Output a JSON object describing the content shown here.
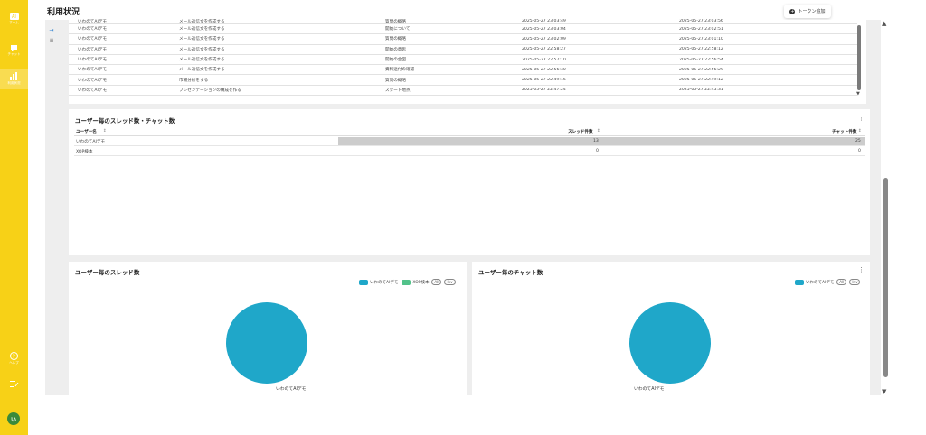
{
  "sidebar": {
    "items": [
      {
        "icon": "home-icon",
        "label": "ホーム"
      },
      {
        "icon": "chat-icon",
        "label": "チャット"
      },
      {
        "icon": "analytics-icon",
        "label": "利用状況"
      },
      {
        "icon": "help-icon",
        "label": "ヘルプ"
      },
      {
        "icon": "notes-icon",
        "label": ""
      }
    ],
    "avatar": "い"
  },
  "header": {
    "title": "利用状況",
    "token_button": "トークン追加"
  },
  "history_table": {
    "rows": [
      [
        "いわのてAIデモ",
        "メール返信文を作成する",
        "質問の概略",
        "2025-05-27 23:03:49",
        "2025-05-27 23:03:56"
      ],
      [
        "いわのてAIデモ",
        "メール返信文を作成する",
        "開始について",
        "2025-05-27 23:03:04",
        "2025-05-27 23:02:51"
      ],
      [
        "いわのてAIデモ",
        "メール返信文を作成する",
        "質問の概略",
        "2025-05-27 23:02:09",
        "2025-05-27 23:01:10"
      ],
      [
        "いわのてAIデモ",
        "メール返信文を作成する",
        "開始の意思",
        "2025-05-27 22:58:27",
        "2025-05-27 22:58:12"
      ],
      [
        "いわのてAIデモ",
        "メール返信文を作成する",
        "開始の合図",
        "2025-05-27 22:57:10",
        "2025-05-27 22:56:54"
      ],
      [
        "いわのてAIデモ",
        "メール返信文を作成する",
        "資料送付の確認",
        "2025-05-27 22:56:40",
        "2025-05-27 22:56:29"
      ],
      [
        "いわのてAIデモ",
        "市場分析をする",
        "質問の概略",
        "2025-05-27 22:49:16",
        "2025-05-27 22:49:12"
      ],
      [
        "いわのてAIデモ",
        "プレゼンテーションの構成を作る",
        "スタート地点",
        "2025-05-27 22:47:24",
        "2025-05-27 22:45:31"
      ]
    ]
  },
  "threads_chats": {
    "title": "ユーザー毎のスレッド数・チャット数",
    "columns": [
      "ユーザー名",
      "スレッド件数",
      "チャット件数"
    ],
    "rows": [
      {
        "user": "いわのてAIデモ",
        "threads": "13",
        "chats": "25"
      },
      {
        "user": "XOP検本",
        "threads": "0",
        "chats": "0"
      }
    ]
  },
  "thread_pie": {
    "title": "ユーザー毎のスレッド数",
    "legend": [
      "いわのてAIデモ",
      "XOP検本"
    ],
    "pills": [
      "All",
      "Inv"
    ],
    "slice_label": "いわのてAIデモ"
  },
  "chat_pie": {
    "title": "ユーザー毎のチャット数",
    "legend": [
      "いわのてAIデモ"
    ],
    "pills": [
      "All",
      "Inv"
    ],
    "slice_label": "いわのてAIデモ"
  },
  "colors": {
    "rail": "#f7d117",
    "pie_primary": "#1fa7c9",
    "pie_secondary": "#52c28a"
  }
}
